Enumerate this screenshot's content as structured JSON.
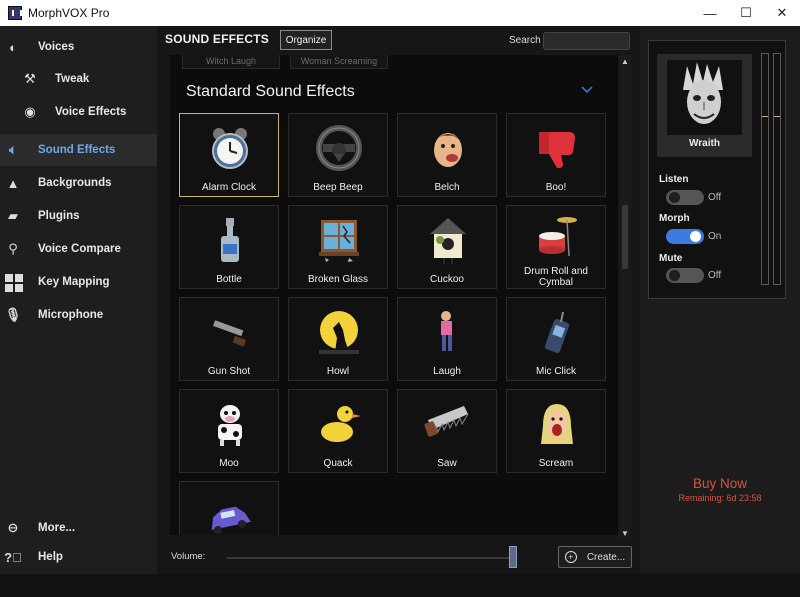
{
  "window": {
    "title": "MorphVOX Pro",
    "minimize": "—",
    "maximize": "☐",
    "close": "✕"
  },
  "sidebar": {
    "items": [
      {
        "label": "Voices",
        "icon": "voices-icon",
        "active": false,
        "sub": false
      },
      {
        "label": "Tweak",
        "icon": "tools-icon",
        "active": false,
        "sub": true
      },
      {
        "label": "Voice Effects",
        "icon": "lips-icon",
        "active": false,
        "sub": true
      },
      {
        "label": "Sound Effects",
        "icon": "speaker-icon",
        "active": true,
        "sub": false
      },
      {
        "label": "Backgrounds",
        "icon": "landscape-icon",
        "active": false,
        "sub": false
      },
      {
        "label": "Plugins",
        "icon": "plug-icon",
        "active": false,
        "sub": false
      },
      {
        "label": "Voice Compare",
        "icon": "magnifier-icon",
        "active": false,
        "sub": false
      },
      {
        "label": "Key Mapping",
        "icon": "keyboard-icon",
        "active": false,
        "sub": false
      },
      {
        "label": "Microphone",
        "icon": "microphone-icon",
        "active": false,
        "sub": false
      }
    ],
    "more": "More...",
    "help": "Help"
  },
  "main": {
    "header": "SOUND EFFECTS",
    "organize": "Organize",
    "search_label": "Search",
    "search_value": "",
    "previous_row": [
      "Witch Laugh",
      "Woman Screaming"
    ],
    "section_title": "Standard Sound Effects",
    "tiles": [
      {
        "label": "Alarm Clock",
        "icon": "alarm-clock-icon",
        "selected": true
      },
      {
        "label": "Beep Beep",
        "icon": "steering-wheel-icon",
        "selected": false
      },
      {
        "label": "Belch",
        "icon": "belch-face-icon",
        "selected": false
      },
      {
        "label": "Boo!",
        "icon": "thumbs-down-icon",
        "selected": false
      },
      {
        "label": "Bottle",
        "icon": "bottle-icon",
        "selected": false
      },
      {
        "label": "Broken Glass",
        "icon": "broken-window-icon",
        "selected": false
      },
      {
        "label": "Cuckoo",
        "icon": "cuckoo-clock-icon",
        "selected": false
      },
      {
        "label": "Drum Roll and Cymbal",
        "icon": "drum-icon",
        "selected": false
      },
      {
        "label": "Gun Shot",
        "icon": "gun-icon",
        "selected": false
      },
      {
        "label": "Howl",
        "icon": "wolf-moon-icon",
        "selected": false
      },
      {
        "label": "Laugh",
        "icon": "laughing-person-icon",
        "selected": false
      },
      {
        "label": "Mic Click",
        "icon": "walkie-talkie-icon",
        "selected": false
      },
      {
        "label": "Moo",
        "icon": "cow-icon",
        "selected": false
      },
      {
        "label": "Quack",
        "icon": "duck-icon",
        "selected": false
      },
      {
        "label": "Saw",
        "icon": "saw-icon",
        "selected": false
      },
      {
        "label": "Scream",
        "icon": "screaming-woman-icon",
        "selected": false
      },
      {
        "label": "",
        "icon": "car-icon",
        "selected": false
      }
    ],
    "volume_label": "Volume:",
    "volume_level": 0.98,
    "create": "Create..."
  },
  "right": {
    "voice_name": "Wraith",
    "listen": {
      "label": "Listen",
      "state": "Off"
    },
    "morph": {
      "label": "Morph",
      "state": "On"
    },
    "mute": {
      "label": "Mute",
      "state": "Off"
    },
    "buy_now": "Buy Now",
    "remaining": "Remaining: 6d 23:58"
  },
  "colors": {
    "accent_blue": "#6fa8e8",
    "toggle_on": "#3d7be0",
    "buy_red": "#d9533b",
    "selected_border": "#c9b464"
  }
}
